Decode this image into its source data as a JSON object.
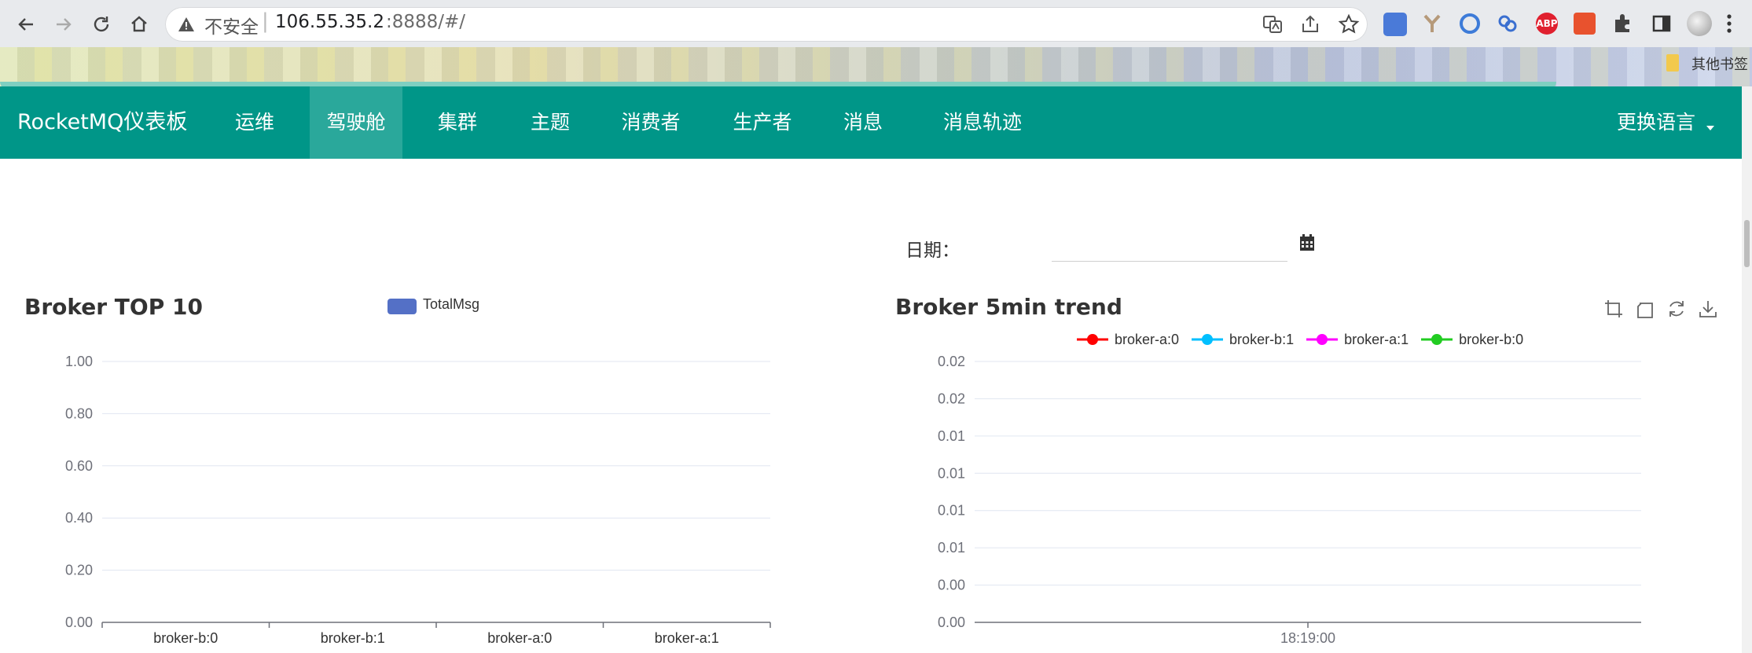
{
  "browser": {
    "security_label": "不安全",
    "url_host": "106.55.35.2",
    "url_rest": ":8888/#/",
    "bookmark_other": "其他书签",
    "extension_abp": "ABP"
  },
  "app": {
    "brand": "RocketMQ仪表板",
    "nav": [
      "运维",
      "驾驶舱",
      "集群",
      "主题",
      "消费者",
      "生产者",
      "消息",
      "消息轨迹"
    ],
    "active_nav": "驾驶舱",
    "language_menu": "更换语言",
    "colors": {
      "navbar": "#009688",
      "active_tab": "#2aa89b"
    }
  },
  "date_filter": {
    "label": "日期：",
    "value": "",
    "icon": "calendar-icon"
  },
  "chart_data": [
    {
      "type": "bar",
      "title": "Broker TOP 10",
      "legend": [
        "TotalMsg"
      ],
      "categories": [
        "broker-b:0",
        "broker-b:1",
        "broker-a:0",
        "broker-a:1"
      ],
      "series": [
        {
          "name": "TotalMsg",
          "values": [
            0,
            0,
            0,
            0
          ],
          "color": "#5470c6"
        }
      ],
      "ylim": [
        0,
        1
      ],
      "yticks": [
        "1.00",
        "0.80",
        "0.60",
        "0.40",
        "0.20",
        "0.00"
      ],
      "grid": true,
      "legend_position": "top-center"
    },
    {
      "type": "line",
      "title": "Broker 5min trend",
      "legend_position": "top-center",
      "x": [
        "18:19:00"
      ],
      "yticks": [
        "0.02",
        "0.02",
        "0.01",
        "0.01",
        "0.01",
        "0.01",
        "0.00",
        "0.00"
      ],
      "series": [
        {
          "name": "broker-a:0",
          "color": "#ff0000",
          "values": []
        },
        {
          "name": "broker-b:1",
          "color": "#00bfff",
          "values": []
        },
        {
          "name": "broker-a:1",
          "color": "#ff00ff",
          "values": []
        },
        {
          "name": "broker-b:0",
          "color": "#22cc22",
          "values": []
        }
      ],
      "toolbox": [
        "zoom-icon",
        "zoom-reset-icon",
        "restore-icon",
        "save-image-icon"
      ],
      "grid": true
    }
  ]
}
